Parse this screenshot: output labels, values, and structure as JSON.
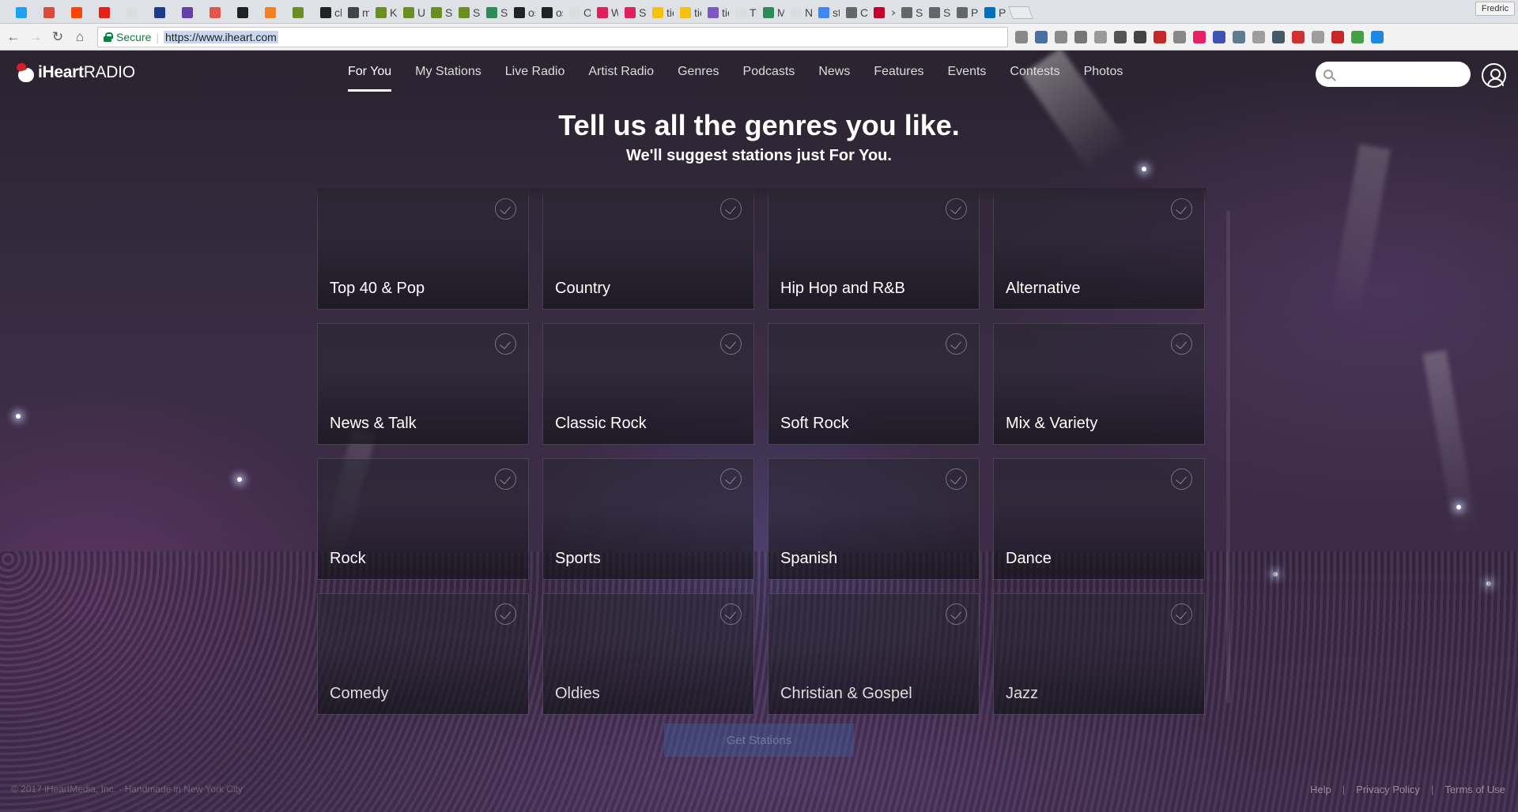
{
  "browser": {
    "tabs": [
      {
        "favicon": "twitter-icon",
        "color": "#1da1f2",
        "title": ""
      },
      {
        "favicon": "trello-icon",
        "color": "#d94b3a",
        "title": ""
      },
      {
        "favicon": "reddit-icon",
        "color": "#ff4500",
        "title": ""
      },
      {
        "favicon": "youtube-icon",
        "color": "#e62117",
        "title": ""
      },
      {
        "favicon": "blank-page-icon",
        "color": "#dddddd",
        "title": ""
      },
      {
        "favicon": "r-icon",
        "color": "#1e3a8a",
        "title": ""
      },
      {
        "favicon": "twitch-icon",
        "color": "#6441a5",
        "title": ""
      },
      {
        "favicon": "letter-icon",
        "color": "#e5554f",
        "title": ""
      },
      {
        "favicon": "github-icon",
        "color": "#222222",
        "title": ""
      },
      {
        "favicon": "stackoverflow-icon",
        "color": "#f48024",
        "title": ""
      },
      {
        "favicon": "leaf-icon",
        "color": "#6b8e23",
        "title": ""
      },
      {
        "favicon": "github-icon",
        "color": "#222222",
        "title": "ch"
      },
      {
        "favicon": "medium-icon",
        "color": "#444444",
        "title": "m"
      },
      {
        "favicon": "leaf-icon",
        "color": "#6b8e23",
        "title": "Kr"
      },
      {
        "favicon": "leaf-icon",
        "color": "#6b8e23",
        "title": "Ut"
      },
      {
        "favicon": "leaf-icon",
        "color": "#6b8e23",
        "title": "Sk"
      },
      {
        "favicon": "leaf-icon",
        "color": "#6b8e23",
        "title": "Sk"
      },
      {
        "favicon": "chart-icon",
        "color": "#2e8b57",
        "title": "Se"
      },
      {
        "favicon": "github-icon",
        "color": "#222222",
        "title": "os"
      },
      {
        "favicon": "github-icon",
        "color": "#222222",
        "title": "os"
      },
      {
        "favicon": "blank-page-icon",
        "color": "#dddddd",
        "title": "Or"
      },
      {
        "favicon": "slack-icon",
        "color": "#e01e5a",
        "title": "Wi"
      },
      {
        "favicon": "slack-icon",
        "color": "#e01e5a",
        "title": "Sla"
      },
      {
        "favicon": "pen-icon",
        "color": "#f4c20d",
        "title": "tic"
      },
      {
        "favicon": "pen-icon",
        "color": "#f4c20d",
        "title": "tic"
      },
      {
        "favicon": "h-icon",
        "color": "#7e57c2",
        "title": "tic"
      },
      {
        "favicon": "blank-page-icon",
        "color": "#dddddd",
        "title": "Ti"
      },
      {
        "favicon": "chart-icon",
        "color": "#2e8b57",
        "title": "Mi"
      },
      {
        "favicon": "blank-page-icon",
        "color": "#dddddd",
        "title": "New"
      },
      {
        "favicon": "google-icon",
        "color": "#4285f4",
        "title": "st"
      },
      {
        "favicon": "wikipedia-icon",
        "color": "#666666",
        "title": "Cc"
      },
      {
        "favicon": "iheart-icon",
        "color": "#c6002b",
        "title": "",
        "active": true,
        "closable": true
      },
      {
        "favicon": "wikipedia-icon",
        "color": "#666666",
        "title": "Sc"
      },
      {
        "favicon": "wikipedia-icon",
        "color": "#666666",
        "title": "Sp"
      },
      {
        "favicon": "wikipedia-icon",
        "color": "#666666",
        "title": "Pa"
      },
      {
        "favicon": "paypal-icon",
        "color": "#0070ba",
        "title": "Pa"
      }
    ],
    "close_glyph": "×",
    "profile_name": "Fredric",
    "secure_label": "Secure",
    "url": "https://www.iheart.com",
    "extension_colors": [
      "#888888",
      "#4a6fa5",
      "#8a8a8a",
      "#777777",
      "#999999",
      "#555555",
      "#444444",
      "#c62828",
      "#888888",
      "#e91e63",
      "#3f51b5",
      "#607d8b",
      "#9e9e9e",
      "#455a64",
      "#d32f2f",
      "#9e9e9e",
      "#c62828",
      "#43a047",
      "#1e88e5"
    ]
  },
  "site": {
    "logo_bold": "iHeart",
    "logo_light": "RADIO",
    "nav": [
      "For You",
      "My Stations",
      "Live Radio",
      "Artist Radio",
      "Genres",
      "Podcasts",
      "News",
      "Features",
      "Events",
      "Contests",
      "Photos"
    ],
    "active_nav": "For You",
    "search_placeholder": ""
  },
  "onboarding": {
    "heading": "Tell us all the genres you like.",
    "subheading": "We'll suggest stations just For You.",
    "genres": [
      "Top 40 & Pop",
      "Country",
      "Hip Hop and R&B",
      "Alternative",
      "News & Talk",
      "Classic Rock",
      "Soft Rock",
      "Mix & Variety",
      "Rock",
      "Sports",
      "Spanish",
      "Dance",
      "Comedy",
      "Oldies",
      "Christian & Gospel",
      "Jazz"
    ],
    "cta_label": "Get Stations"
  },
  "footer": {
    "copyright": "© 2017 iHeartMedia, Inc. · Handmade in New York City",
    "links": [
      "Help",
      "Privacy Policy",
      "Terms of Use"
    ]
  }
}
